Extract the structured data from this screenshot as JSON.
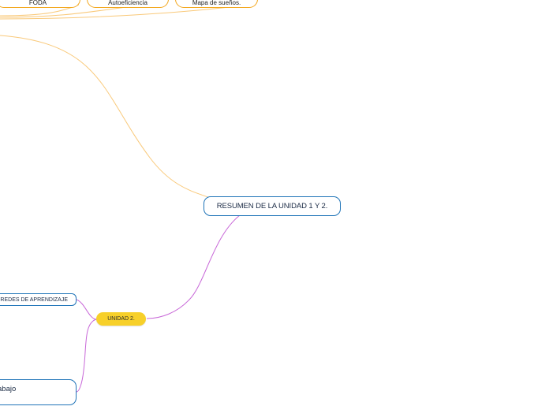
{
  "mindmap": {
    "root": {
      "label": "RESUMEN DE LA UNIDAD 1 Y 2."
    },
    "top_branches": [
      {
        "label": "FODA"
      },
      {
        "label": "Autoeficiencia"
      },
      {
        "label": "Mapa de sueños."
      }
    ],
    "unidad2": {
      "label": "UNIDAD 2.",
      "children": [
        {
          "label": "REDES DE APRENDIZAJE"
        },
        {
          "label": "abajo"
        }
      ]
    }
  },
  "colors": {
    "orange_branch": "#f3a81f",
    "orange_connector": "#f9c97a",
    "purple_connector": "#c868d8",
    "blue_border": "#1f74b8",
    "unidad2_fill": "#f7d02a"
  }
}
